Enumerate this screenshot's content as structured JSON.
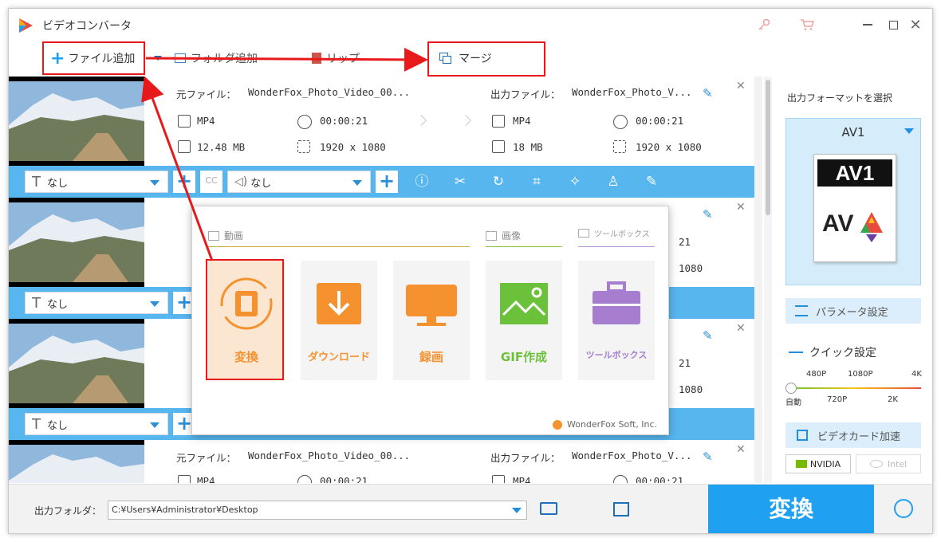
{
  "window": {
    "title": "ビデオコンバータ"
  },
  "toolbar": {
    "add_file": "ファイル追加",
    "add_folder": "フォルダ追加",
    "split": "リップ",
    "merge": "マージ"
  },
  "items": [
    {
      "source_label": "元ファイル：",
      "source_name": "WonderFox_Photo_Video_00...",
      "output_label": "出力ファイル：",
      "output_name": "WonderFox_Photo_V...",
      "src_format": "MP4",
      "src_duration": "00:00:21",
      "src_size": "12.48 MB",
      "src_res": "1920 x 1080",
      "out_format": "MP4",
      "out_duration": "00:00:21",
      "out_size": "18 MB",
      "out_res": "1920 x 1080",
      "subtitle": "なし",
      "audio": "なし"
    },
    {
      "subtitle": "なし",
      "res_tail": "1080",
      "dur_tail": "21"
    },
    {
      "subtitle": "なし",
      "res_tail": "1080",
      "dur_tail": "21"
    },
    {
      "source_label": "元ファイル：",
      "source_name": "WonderFox_Photo_Video_00...",
      "output_label": "出力ファイル：",
      "output_name": "WonderFox_Photo_V...",
      "src_format": "MP4",
      "src_duration": "00:00:21",
      "out_format": "MP4",
      "out_duration": "00:00:21"
    }
  ],
  "popup": {
    "sections": {
      "video": "動画",
      "image": "画像",
      "toolbox": "ツールボックス"
    },
    "tiles": [
      {
        "label": "変換",
        "color": "#f5922f"
      },
      {
        "label": "ダウンロード",
        "color": "#f5922f"
      },
      {
        "label": "録画",
        "color": "#f5922f"
      },
      {
        "label": "GIF作成",
        "color": "#6cc13a"
      },
      {
        "label": "ツールボックス",
        "color": "#a77dd0"
      }
    ],
    "brand": "WonderFox Soft, Inc."
  },
  "right": {
    "format_header": "出力フォーマットを選択",
    "format_name": "AV1",
    "format_badge": "AV1",
    "param_button": "パラメータ設定",
    "quick_label": "クイック設定",
    "quality_top": [
      "480P",
      "1080P",
      "4K"
    ],
    "quality_bottom": [
      "自動",
      "720P",
      "2K"
    ],
    "gpu_button": "ビデオカード加速",
    "nvidia": "NVIDIA",
    "intel": "Intel"
  },
  "bottom": {
    "output_label": "出力フォルダ：",
    "output_path": "C:¥Users¥Administrator¥Desktop",
    "convert": "変換"
  },
  "colors": {
    "accent": "#1fa0f0",
    "itembar": "#57b6ee",
    "annotation": "#e8191b"
  }
}
